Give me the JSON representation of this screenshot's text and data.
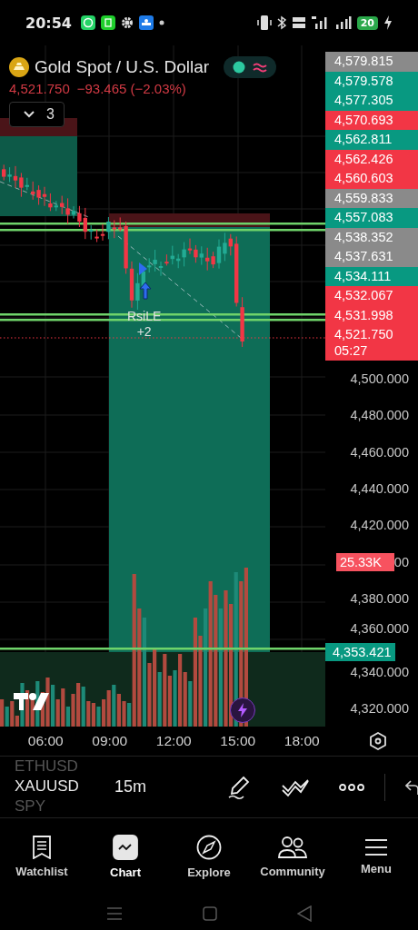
{
  "status_bar": {
    "time": "20:54",
    "battery": "20"
  },
  "symbol": {
    "title": "Gold Spot / U.S. Dollar",
    "price": "4,521.750",
    "change": "−93.465 (−2.03%)",
    "market_open": true
  },
  "indicators_button": {
    "count": "3",
    "expanded": false
  },
  "price_labels": [
    {
      "value": "4,579.815",
      "color": "#8a8a8a"
    },
    {
      "value": "4,579.578",
      "color": "#089981"
    },
    {
      "value": "4,577.305",
      "color": "#089981"
    },
    {
      "value": "4,570.693",
      "color": "#f23645"
    },
    {
      "value": "4,562.811",
      "color": "#089981"
    },
    {
      "value": "4,562.426",
      "color": "#f23645"
    },
    {
      "value": "4,560.603",
      "color": "#f23645"
    },
    {
      "value": "4,559.833",
      "color": "#8a8a8a"
    },
    {
      "value": "4,557.083",
      "color": "#089981"
    },
    {
      "value": "4,538.352",
      "color": "#8a8a8a"
    },
    {
      "value": "4,537.631",
      "color": "#8a8a8a"
    },
    {
      "value": "4,534.111",
      "color": "#089981"
    },
    {
      "value": "4,532.067",
      "color": "#f23645"
    },
    {
      "value": "4,531.998",
      "color": "#f23645"
    },
    {
      "value": "4,521.750",
      "color": "#f23645",
      "countdown": "05:27"
    }
  ],
  "price_ticks": [
    {
      "label": "4,500.000"
    },
    {
      "label": "4,480.000"
    },
    {
      "label": "4,460.000"
    },
    {
      "label": "4,440.000"
    },
    {
      "label": "4,420.000"
    },
    {
      "label": "00",
      "badge": {
        "text": "25.33K",
        "color": "#f7525f",
        "kind": "volume"
      }
    },
    {
      "label": "4,380.000"
    },
    {
      "label": "4,360.000",
      "badge": {
        "text": "4,353.421",
        "color": "#089981",
        "kind": "line"
      }
    },
    {
      "label": "4,340.000"
    },
    {
      "label": "4,320.000"
    }
  ],
  "signal": {
    "name": "RsiLE",
    "count": "+2"
  },
  "time_ticks": [
    "06:00",
    "09:00",
    "12:00",
    "15:00",
    "18:00"
  ],
  "toolbar": {
    "symbols": [
      {
        "label": "ETHUSD",
        "selected": false
      },
      {
        "label": "XAUUSD",
        "selected": true
      },
      {
        "label": "SPY",
        "selected": false
      }
    ],
    "interval": "15m"
  },
  "nav": [
    {
      "label": "Watchlist",
      "selected": false
    },
    {
      "label": "Chart",
      "selected": true
    },
    {
      "label": "Explore",
      "selected": false
    },
    {
      "label": "Community",
      "selected": false
    },
    {
      "label": "Menu",
      "selected": false
    }
  ]
}
